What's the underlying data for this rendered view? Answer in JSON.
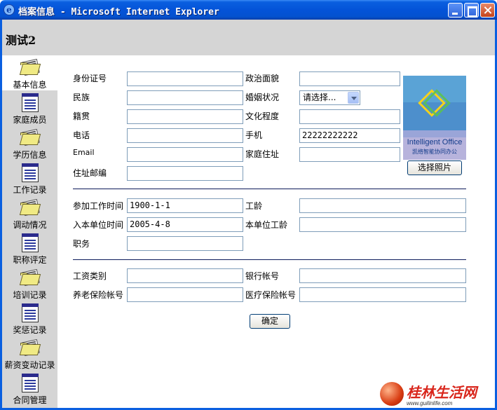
{
  "window": {
    "title": "档案信息 - Microsoft Internet Explorer"
  },
  "page": {
    "heading": "测试2"
  },
  "sidebar": {
    "items": [
      {
        "label": "基本信息",
        "icon": "folder-icon",
        "active": true
      },
      {
        "label": "家庭成员",
        "icon": "document-icon",
        "active": false
      },
      {
        "label": "学历信息",
        "icon": "folder-icon",
        "active": false
      },
      {
        "label": "工作记录",
        "icon": "document-icon",
        "active": false
      },
      {
        "label": "调动情况",
        "icon": "folder-icon",
        "active": false
      },
      {
        "label": "职称评定",
        "icon": "document-icon",
        "active": false
      },
      {
        "label": "培训记录",
        "icon": "folder-icon",
        "active": false
      },
      {
        "label": "奖惩记录",
        "icon": "document-icon",
        "active": false
      },
      {
        "label": "薪资变动记录",
        "icon": "folder-icon",
        "active": false
      },
      {
        "label": "合同管理",
        "icon": "document-icon",
        "active": false
      }
    ]
  },
  "form": {
    "basic": {
      "id_number": {
        "label": "身份证号",
        "value": ""
      },
      "political_status": {
        "label": "政治面貌",
        "value": ""
      },
      "ethnicity": {
        "label": "民族",
        "value": ""
      },
      "marital_status": {
        "label": "婚姻状况",
        "value": "请选择..."
      },
      "native_place": {
        "label": "籍贯",
        "value": ""
      },
      "education": {
        "label": "文化程度",
        "value": ""
      },
      "phone": {
        "label": "电话",
        "value": ""
      },
      "mobile": {
        "label": "手机",
        "value": "22222222222"
      },
      "email": {
        "label": "Email",
        "value": ""
      },
      "home_address": {
        "label": "家庭住址",
        "value": ""
      },
      "postal_code": {
        "label": "住址邮编",
        "value": ""
      }
    },
    "work": {
      "start_work_date": {
        "label": "参加工作时间",
        "value": "1900-1-1"
      },
      "work_years": {
        "label": "工龄",
        "value": ""
      },
      "join_unit_date": {
        "label": "入本单位时间",
        "value": "2005-4-8"
      },
      "unit_years": {
        "label": "本单位工龄",
        "value": ""
      },
      "position": {
        "label": "职务",
        "value": ""
      }
    },
    "finance": {
      "salary_type": {
        "label": "工资类别",
        "value": ""
      },
      "bank_account": {
        "label": "银行帐号",
        "value": ""
      },
      "pension_account": {
        "label": "养老保险帐号",
        "value": ""
      },
      "medical_account": {
        "label": "医疗保险帐号",
        "value": ""
      }
    },
    "photo": {
      "text": "Intelligent Office",
      "subtext": "凯络智能协同办公",
      "button_label": "选择照片"
    },
    "submit_label": "确定"
  },
  "watermark": {
    "title": "桂林生活网",
    "url": "www.guilinlife.com"
  }
}
